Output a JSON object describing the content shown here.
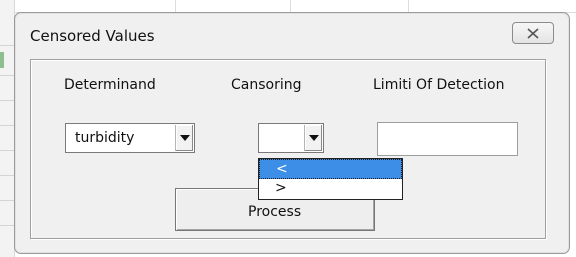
{
  "window": {
    "title": "Censored Values"
  },
  "labels": {
    "determinand": "Determinand",
    "censoring": "Cansoring",
    "limit_of_detection": "Limiti Of Detection"
  },
  "determinand_combo": {
    "value": "turbidity"
  },
  "censoring_combo": {
    "value": "",
    "options": [
      "<",
      ">"
    ],
    "selected_option": "<"
  },
  "limit_input": {
    "value": ""
  },
  "process_button": {
    "label": "Process"
  },
  "icons": {
    "close": "close-icon",
    "dropdown": "chevron-down-icon"
  }
}
